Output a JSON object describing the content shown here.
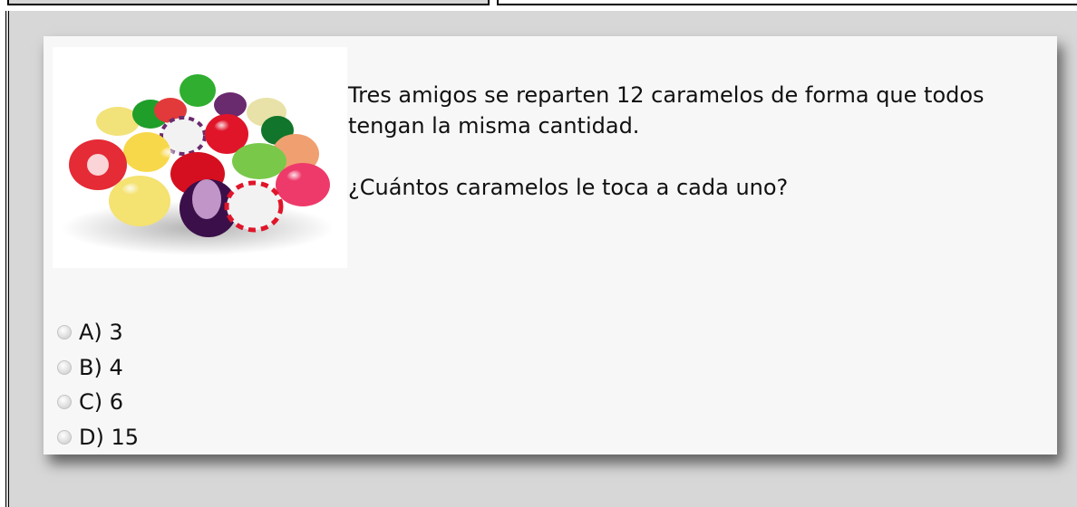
{
  "question": {
    "image": "candy-pile-image",
    "text_line1": "Tres amigos se reparten 12 caramelos de forma que todos tengan la misma cantidad.",
    "text_line2": "¿Cuántos caramelos le toca a cada uno?"
  },
  "options": [
    {
      "label": "A) 3"
    },
    {
      "label": "B) 4"
    },
    {
      "label": "C) 6"
    },
    {
      "label": "D) 15"
    }
  ]
}
